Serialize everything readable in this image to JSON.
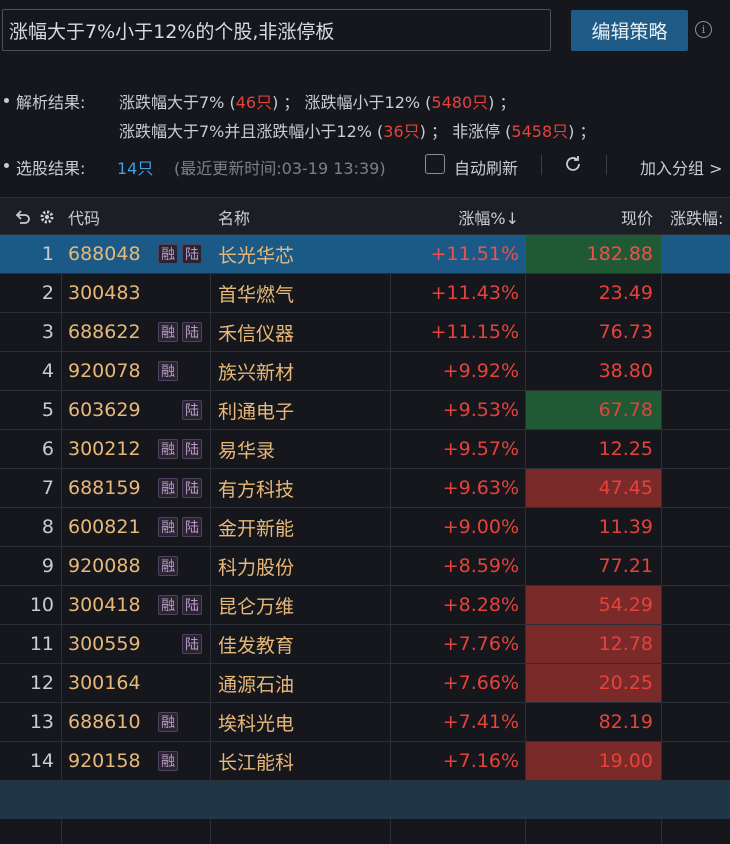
{
  "search": {
    "query": "涨幅大于7%小于12%的个股,非涨停板"
  },
  "edit_button": "编辑策略",
  "parse": {
    "label": "解析结果:",
    "line1": [
      {
        "text": "涨跌幅大于7% (",
        "color": "normal"
      },
      {
        "text": "46只",
        "color": "red"
      },
      {
        "text": ")  ；  涨跌幅小于12% (",
        "color": "normal"
      },
      {
        "text": "5480只",
        "color": "red"
      },
      {
        "text": ")  ；",
        "color": "normal"
      }
    ],
    "line2": [
      {
        "text": "涨跌幅大于7%并且涨跌幅小于12% (",
        "color": "normal"
      },
      {
        "text": "36只",
        "color": "red"
      },
      {
        "text": ")  ；  非涨停 (",
        "color": "normal"
      },
      {
        "text": "5458只",
        "color": "red"
      },
      {
        "text": ")  ；",
        "color": "normal"
      }
    ]
  },
  "selection": {
    "label": "选股结果:",
    "count": "14只",
    "updated": "(最近更新时间:03-19 13:39)",
    "auto_refresh": "自动刷新",
    "add_group": "加入分组 >"
  },
  "table": {
    "headers": {
      "code": "代码",
      "name": "名称",
      "change": "涨幅%↓",
      "price": "现价",
      "range": "涨跌幅:"
    },
    "rows": [
      {
        "idx": "1",
        "code": "688048",
        "name": "长光华芯",
        "change": "+11.51%",
        "price": "182.88",
        "tags": [
          "融",
          "陆"
        ],
        "hl": "green",
        "selected": true
      },
      {
        "idx": "2",
        "code": "300483",
        "name": "首华燃气",
        "change": "+11.43%",
        "price": "23.49",
        "tags": [],
        "hl": "",
        "selected": false
      },
      {
        "idx": "3",
        "code": "688622",
        "name": "禾信仪器",
        "change": "+11.15%",
        "price": "76.73",
        "tags": [
          "融",
          "陆"
        ],
        "hl": "",
        "selected": false
      },
      {
        "idx": "4",
        "code": "920078",
        "name": "族兴新材",
        "change": "+9.92%",
        "price": "38.80",
        "tags": [
          "融"
        ],
        "hl": "",
        "selected": false
      },
      {
        "idx": "5",
        "code": "603629",
        "name": "利通电子",
        "change": "+9.53%",
        "price": "67.78",
        "tags": [
          "陆"
        ],
        "hl": "green",
        "selected": false
      },
      {
        "idx": "6",
        "code": "300212",
        "name": "易华录",
        "change": "+9.57%",
        "price": "12.25",
        "tags": [
          "融",
          "陆"
        ],
        "hl": "",
        "selected": false
      },
      {
        "idx": "7",
        "code": "688159",
        "name": "有方科技",
        "change": "+9.63%",
        "price": "47.45",
        "tags": [
          "融",
          "陆"
        ],
        "hl": "red",
        "selected": false
      },
      {
        "idx": "8",
        "code": "600821",
        "name": "金开新能",
        "change": "+9.00%",
        "price": "11.39",
        "tags": [
          "融",
          "陆"
        ],
        "hl": "",
        "selected": false
      },
      {
        "idx": "9",
        "code": "920088",
        "name": "科力股份",
        "change": "+8.59%",
        "price": "77.21",
        "tags": [
          "融"
        ],
        "hl": "",
        "selected": false
      },
      {
        "idx": "10",
        "code": "300418",
        "name": "昆仑万维",
        "change": "+8.28%",
        "price": "54.29",
        "tags": [
          "融",
          "陆"
        ],
        "hl": "red",
        "selected": false
      },
      {
        "idx": "11",
        "code": "300559",
        "name": "佳发教育",
        "change": "+7.76%",
        "price": "12.78",
        "tags": [
          "陆"
        ],
        "hl": "red",
        "selected": false
      },
      {
        "idx": "12",
        "code": "300164",
        "name": "通源石油",
        "change": "+7.66%",
        "price": "20.25",
        "tags": [],
        "hl": "red",
        "selected": false
      },
      {
        "idx": "13",
        "code": "688610",
        "name": "埃科光电",
        "change": "+7.41%",
        "price": "82.19",
        "tags": [
          "融"
        ],
        "hl": "",
        "selected": false
      },
      {
        "idx": "14",
        "code": "920158",
        "name": "长江能科",
        "change": "+7.16%",
        "price": "19.00",
        "tags": [
          "融"
        ],
        "hl": "red",
        "selected": false
      }
    ]
  }
}
